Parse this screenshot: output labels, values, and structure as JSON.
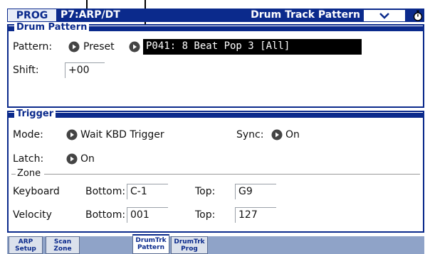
{
  "title_bar": {
    "mode": "PROG",
    "page": "P7:ARP/DT",
    "title": "Drum Track Pattern",
    "menu_icon": "chevron-down-icon",
    "extra_icon": "stopwatch-icon"
  },
  "drum_pattern": {
    "section_label": "Drum Pattern",
    "pattern_label": "Pattern:",
    "bank_value": "Preset",
    "pattern_value": "P041: 8 Beat Pop 3 [All]",
    "shift_label": "Shift:",
    "shift_value": "+00"
  },
  "trigger": {
    "section_label": "Trigger",
    "mode_label": "Mode:",
    "mode_value": "Wait KBD Trigger",
    "sync_label": "Sync:",
    "sync_value": "On",
    "latch_label": "Latch:",
    "latch_value": "On",
    "zone_label": "Zone",
    "keyboard_label": "Keyboard",
    "keyboard_bottom_label": "Bottom:",
    "keyboard_bottom_value": "C-1",
    "keyboard_top_label": "Top:",
    "keyboard_top_value": "G9",
    "velocity_label": "Velocity",
    "velocity_bottom_label": "Bottom:",
    "velocity_bottom_value": "001",
    "velocity_top_label": "Top:",
    "velocity_top_value": "127"
  },
  "tabs": [
    {
      "line1": "ARP",
      "line2": "Setup"
    },
    {
      "line1": "Scan",
      "line2": "Zone"
    },
    {
      "line1": "DrumTrk",
      "line2": "Pattern"
    },
    {
      "line1": "DrumTrk",
      "line2": "Prog"
    }
  ],
  "colors": {
    "accent": "#0b2a8c",
    "selected_field_bg": "#000000",
    "tab_bar": "#8fa3c8"
  }
}
